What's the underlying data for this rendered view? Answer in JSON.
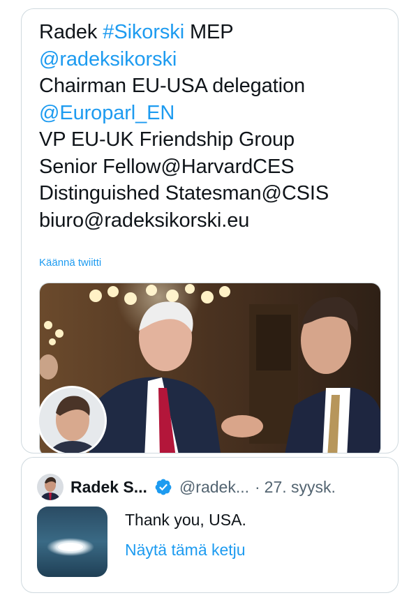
{
  "bio": {
    "name_prefix": "Radek ",
    "name_hashtag": "#Sikorski",
    "name_suffix": " MEP",
    "handle": "@radeksikorski",
    "line_chairman": "Chairman EU-USA delegation",
    "europarl": "@Europarl_EN",
    "line_vp": "VP EU-UK Friendship Group",
    "line_fellow": "Senior Fellow@HarvardCES",
    "line_statesman": "Distinguished Statesman@CSIS",
    "line_email": "biuro@radeksikorski.eu"
  },
  "translate_label": "Käännä twiitti",
  "photo_icon": "photo-of-two-men-shaking-hands",
  "quoted_tweet": {
    "name": "Radek S...",
    "handle": "@radek...",
    "separator": "·",
    "date": "27. syysk.",
    "text": "Thank you, USA.",
    "show_thread": "Näytä tämä ketju",
    "verified_icon": "verified-badge-icon"
  },
  "colors": {
    "link": "#1d9bf0",
    "secondary_text": "#536471",
    "border": "#cfd9de"
  }
}
